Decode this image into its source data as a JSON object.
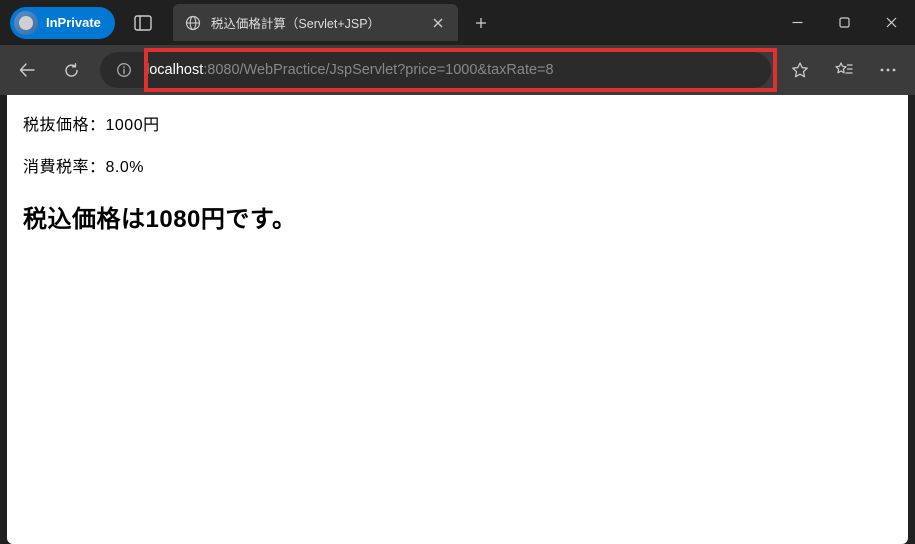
{
  "titlebar": {
    "inprivate_label": "InPrivate",
    "tab_title": "税込価格計算（Servlet+JSP）"
  },
  "toolbar": {
    "url_host": "localhost",
    "url_rest": ":8080/WebPractice/JspServlet?price=1000&taxRate=8"
  },
  "page": {
    "line1": "税抜価格：1000円",
    "line2": "消費税率：8.0%",
    "result": "税込価格は1080円です。"
  }
}
